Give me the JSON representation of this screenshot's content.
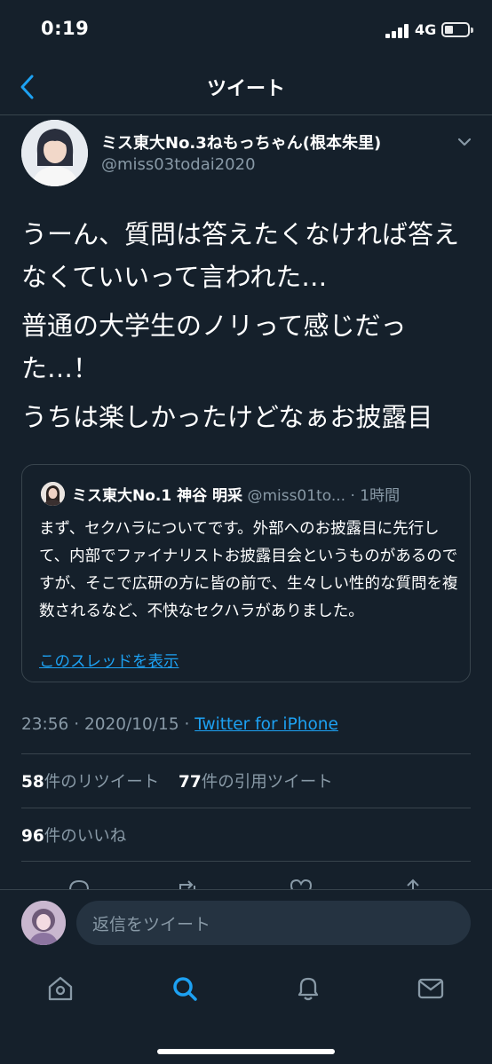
{
  "status": {
    "time": "0:19",
    "network": "4G"
  },
  "header": {
    "title": "ツイート"
  },
  "author": {
    "display_name": "ミス東大No.3ねもっちゃん(根本朱里)",
    "handle": "@miss03todai2020"
  },
  "tweet": {
    "paragraphs": [
      "うーん、質問は答えたくなければ答えなくていいって言われた…",
      "普通の大学生のノリって感じだった…！",
      "うちは楽しかったけどなぁお披露目"
    ]
  },
  "quote": {
    "name": "ミス東大No.1 神谷 明采",
    "handle": "@miss01to...",
    "time": "· 1時間",
    "text": "まず、セクハラについてです。外部へのお披露目に先行して、内部でファイナリストお披露目会というものがあるのですが、そこで広研の方に皆の前で、生々しい性的な質問を複数されるなど、不快なセクハラがありました。",
    "show_thread": "このスレッドを表示"
  },
  "meta": {
    "timestamp": "23:56 · 2020/10/15 · ",
    "source": "Twitter for iPhone"
  },
  "stats": {
    "retweets_count": "58",
    "retweets_label": "件のリツイート",
    "quotes_count": "77",
    "quotes_label": "件の引用ツイート",
    "likes_count": "96",
    "likes_label": "件のいいね"
  },
  "reply": {
    "placeholder": "返信をツイート"
  },
  "tabs": [
    "home-icon",
    "search-icon",
    "notifications-icon",
    "messages-icon"
  ],
  "colors": {
    "background": "#15202b",
    "accent": "#1da1f2",
    "secondary_text": "#8899a6",
    "border": "#38444d"
  }
}
